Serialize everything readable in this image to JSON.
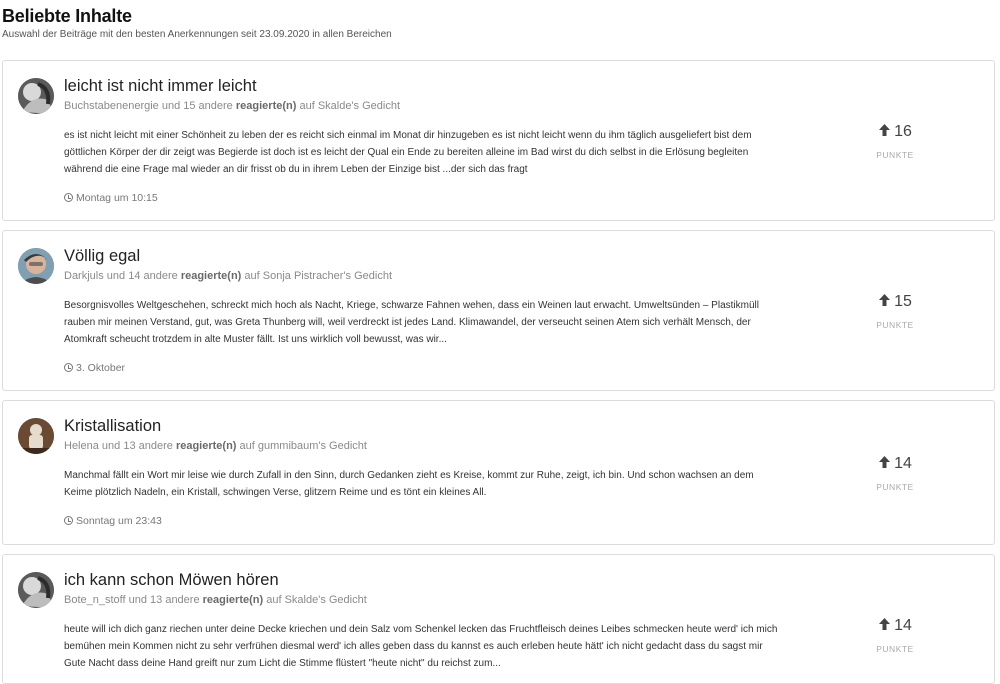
{
  "header": {
    "title": "Beliebte Inhalte",
    "subtitle": "Auswahl der Beiträge mit den besten Anerkennungen seit 23.09.2020 in allen Bereichen"
  },
  "items": [
    {
      "title": "leicht ist nicht immer leicht",
      "meta_users": "Buchstabenenergie und 15 andere",
      "meta_action": "reagierte(n)",
      "meta_target": "auf Skalde's Gedicht",
      "body": "es ist nicht leicht mit einer Schönheit zu leben der es reicht sich einmal im Monat dir hinzugeben es ist nicht leicht wenn du ihm täglich ausgeliefert bist dem göttlichen Körper der dir zeigt was Begierde ist doch ist es leicht der Qual ein Ende zu bereiten alleine im Bad wirst du dich selbst in die Erlösung begleiten während die eine Frage mal wieder an dir frisst ob du in ihrem Leben der Einzige bist ...der sich das fragt",
      "time": "Montag um 10:15",
      "points": "16",
      "points_label": "PUNKTE"
    },
    {
      "title": "Völlig egal",
      "meta_users": "Darkjuls und 14 andere",
      "meta_action": "reagierte(n)",
      "meta_target": "auf Sonja Pistracher's Gedicht",
      "body": "Besorgnisvolles Weltgeschehen, schreckt mich hoch als Nacht, Kriege, schwarze Fahnen wehen, dass ein Weinen laut erwacht. Umweltsünden – Plastikmüll rauben mir meinen Verstand, gut, was Greta Thunberg will, weil verdreckt ist jedes Land. Klimawandel, der verseucht seinen Atem sich verhält Mensch, der Atomkraft scheucht trotzdem in alte Muster fällt. Ist uns wirklich voll bewusst, was wir...",
      "time": "3. Oktober",
      "points": "15",
      "points_label": "PUNKTE"
    },
    {
      "title": "Kristallisation",
      "meta_users": "Helena und 13 andere",
      "meta_action": "reagierte(n)",
      "meta_target": "auf gummibaum's Gedicht",
      "body": "Manchmal fällt ein Wort mir leise wie durch Zufall in den Sinn, durch Gedanken zieht es Kreise, kommt zur Ruhe, zeigt, ich bin. Und schon wachsen an dem Keime plötzlich Nadeln, ein Kristall, schwingen Verse, glitzern Reime und es tönt ein kleines All.",
      "time": "Sonntag um 23:43",
      "points": "14",
      "points_label": "PUNKTE"
    },
    {
      "title": "ich kann schon Möwen hören",
      "meta_users": "Bote_n_stoff und 13 andere",
      "meta_action": "reagierte(n)",
      "meta_target": "auf Skalde's Gedicht",
      "body": "heute will ich dich ganz riechen unter deine Decke kriechen und dein Salz vom Schenkel lecken das Fruchtfleisch deines Leibes schmecken heute werd' ich mich bemühen mein Kommen nicht zu sehr verfrühen diesmal werd' ich alles geben dass du kannst es auch erleben heute hätt' ich nicht gedacht dass du sagst mir Gute Nacht dass deine Hand greift nur zum Licht die Stimme flüstert \"heute nicht\" du reichst zum...",
      "time": "",
      "points": "14",
      "points_label": "PUNKTE"
    }
  ]
}
